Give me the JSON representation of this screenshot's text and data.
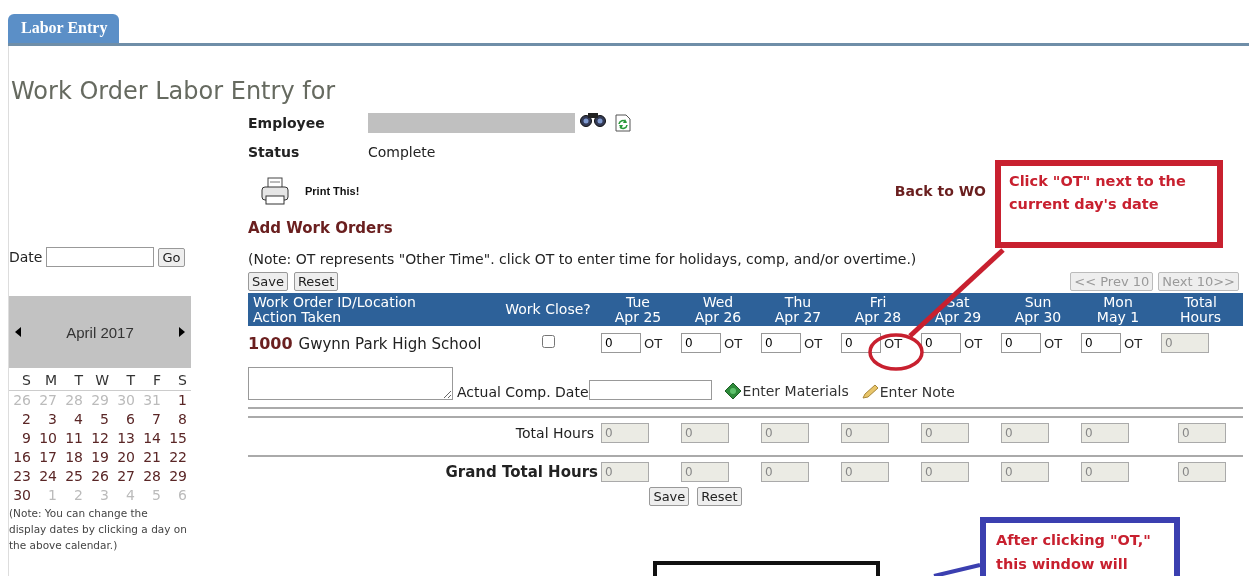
{
  "tab": {
    "label": "Labor Entry",
    "selected": true
  },
  "title": "Work Order Labor Entry for",
  "employee": {
    "label": "Employee",
    "redacted": true
  },
  "status": {
    "label": "Status",
    "value": "Complete"
  },
  "print_link": "Print This!",
  "back_link": "Back to WO",
  "add_link": "Add Work Orders",
  "date_filter": {
    "label": "Date",
    "button": "Go"
  },
  "calendar": {
    "month": "April 2017",
    "weekdays": [
      "S",
      "M",
      "T",
      "W",
      "T",
      "F",
      "S"
    ],
    "weeks": [
      [
        {
          "day": "26",
          "in_month": false
        },
        {
          "day": "27",
          "in_month": false
        },
        {
          "day": "28",
          "in_month": false
        },
        {
          "day": "29",
          "in_month": false
        },
        {
          "day": "30",
          "in_month": false
        },
        {
          "day": "31",
          "in_month": false
        },
        {
          "day": "1",
          "in_month": true
        }
      ],
      [
        {
          "day": "2",
          "in_month": true
        },
        {
          "day": "3",
          "in_month": true
        },
        {
          "day": "4",
          "in_month": true
        },
        {
          "day": "5",
          "in_month": true
        },
        {
          "day": "6",
          "in_month": true
        },
        {
          "day": "7",
          "in_month": true
        },
        {
          "day": "8",
          "in_month": true
        }
      ],
      [
        {
          "day": "9",
          "in_month": true
        },
        {
          "day": "10",
          "in_month": true
        },
        {
          "day": "11",
          "in_month": true
        },
        {
          "day": "12",
          "in_month": true
        },
        {
          "day": "13",
          "in_month": true
        },
        {
          "day": "14",
          "in_month": true
        },
        {
          "day": "15",
          "in_month": true
        }
      ],
      [
        {
          "day": "16",
          "in_month": true
        },
        {
          "day": "17",
          "in_month": true
        },
        {
          "day": "18",
          "in_month": true
        },
        {
          "day": "19",
          "in_month": true
        },
        {
          "day": "20",
          "in_month": true
        },
        {
          "day": "21",
          "in_month": true
        },
        {
          "day": "22",
          "in_month": true
        }
      ],
      [
        {
          "day": "23",
          "in_month": true
        },
        {
          "day": "24",
          "in_month": true
        },
        {
          "day": "25",
          "in_month": true
        },
        {
          "day": "26",
          "in_month": true
        },
        {
          "day": "27",
          "in_month": true
        },
        {
          "day": "28",
          "in_month": true
        },
        {
          "day": "29",
          "in_month": true
        }
      ],
      [
        {
          "day": "30",
          "in_month": true
        },
        {
          "day": "1",
          "in_month": false
        },
        {
          "day": "2",
          "in_month": false
        },
        {
          "day": "3",
          "in_month": false
        },
        {
          "day": "4",
          "in_month": false
        },
        {
          "day": "5",
          "in_month": false
        },
        {
          "day": "6",
          "in_month": false
        }
      ]
    ]
  },
  "calendar_note": "(Note: You can change the display dates by clicking a day on the above calendar.)",
  "ot_note": "(Note: OT represents \"Other Time\". click OT to enter time for holidays, comp, and/or overtime.)",
  "top_buttons": [
    "Save",
    "Reset"
  ],
  "pager": [
    {
      "label": "<< Prev 10",
      "disabled": true
    },
    {
      "label": "Next 10>>",
      "disabled": true
    }
  ],
  "table": {
    "columns": [
      {
        "lines": [
          "Work Order ID/Location",
          "Action Taken"
        ]
      },
      {
        "lines": [
          "Work Close?"
        ]
      },
      {
        "lines": [
          "Tue",
          "Apr 25"
        ]
      },
      {
        "lines": [
          "Wed",
          "Apr 26"
        ]
      },
      {
        "lines": [
          "Thu",
          "Apr 27"
        ]
      },
      {
        "lines": [
          "Fri",
          "Apr 28"
        ]
      },
      {
        "lines": [
          "Sat",
          "Apr 29"
        ]
      },
      {
        "lines": [
          "Sun",
          "Apr 30"
        ]
      },
      {
        "lines": [
          "Mon",
          "May 1"
        ]
      },
      {
        "lines": [
          "Total",
          "Hours"
        ]
      }
    ],
    "rows": [
      {
        "id": "1000",
        "location": "Gwynn Park High School",
        "closed": false,
        "hours": [
          {
            "value": "0",
            "ot": "OT"
          },
          {
            "value": "0",
            "ot": "OT"
          },
          {
            "value": "0",
            "ot": "OT"
          },
          {
            "value": "0",
            "ot": "OT"
          },
          {
            "value": "0",
            "ot": "OT"
          },
          {
            "value": "0",
            "ot": "OT"
          },
          {
            "value": "0",
            "ot": "OT"
          }
        ],
        "total": "0",
        "comp_date_label": "Actual Comp. Date",
        "materials_link": "Enter Materials",
        "note_link": "Enter Note"
      }
    ],
    "totals": {
      "label": "Total Hours",
      "disabled": true,
      "values": [
        "0",
        "0",
        "0",
        "0",
        "0",
        "0",
        "0",
        "0"
      ]
    },
    "grand_totals": {
      "label": "Grand Total Hours",
      "disabled": true,
      "values": [
        "0",
        "0",
        "0",
        "0",
        "0",
        "0",
        "0",
        "0"
      ]
    }
  },
  "bottom_buttons": [
    "Save",
    "Reset"
  ],
  "annotations": [
    {
      "kind": "instruction_callout",
      "text": "Click \"OT\" next to the current day's date",
      "color": "#c8202f"
    },
    {
      "kind": "ring",
      "color": "#c8202f"
    },
    {
      "kind": "window_frame",
      "color": "#111111"
    },
    {
      "kind": "result_callout",
      "text": "After clicking \"OT,\" this window will",
      "color": "#3b3fb0"
    }
  ]
}
